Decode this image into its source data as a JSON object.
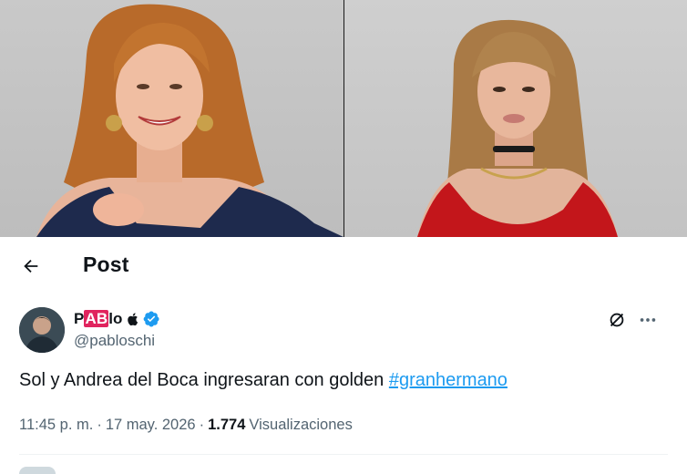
{
  "colors": {
    "text_primary": "#0f1419",
    "text_secondary": "#536471",
    "link": "#1d9bf0",
    "verified": "#1d9bf0",
    "name_highlight": "#e0245e"
  },
  "photos": [
    {
      "icon": "portrait-photo",
      "subject_palette": {
        "hair": "#b5651d",
        "dress": "#1f2a4a"
      }
    },
    {
      "icon": "portrait-photo",
      "subject_palette": {
        "hair": "#a87a45",
        "dress": "#c4161c"
      }
    }
  ],
  "header": {
    "back_icon": "arrow-left-icon",
    "title": "Post"
  },
  "post": {
    "author": {
      "name_prefix": "P",
      "name_highlight": "AB",
      "name_suffix": "lo",
      "apple_icon": "apple-logo-icon",
      "verified_icon": "verified-badge-icon",
      "handle": "@pabloschi"
    },
    "actions": {
      "grok_icon": "grok-slash-icon",
      "more_icon": "more-dots-icon"
    },
    "text": "Sol y Andrea del Boca ingresaran con golden",
    "hashtag": "#granhermano",
    "time": "11:45 p. m.",
    "separator": "·",
    "date": "17 may. 2026",
    "views_count": "1.774",
    "views_label": "Visualizaciones"
  }
}
